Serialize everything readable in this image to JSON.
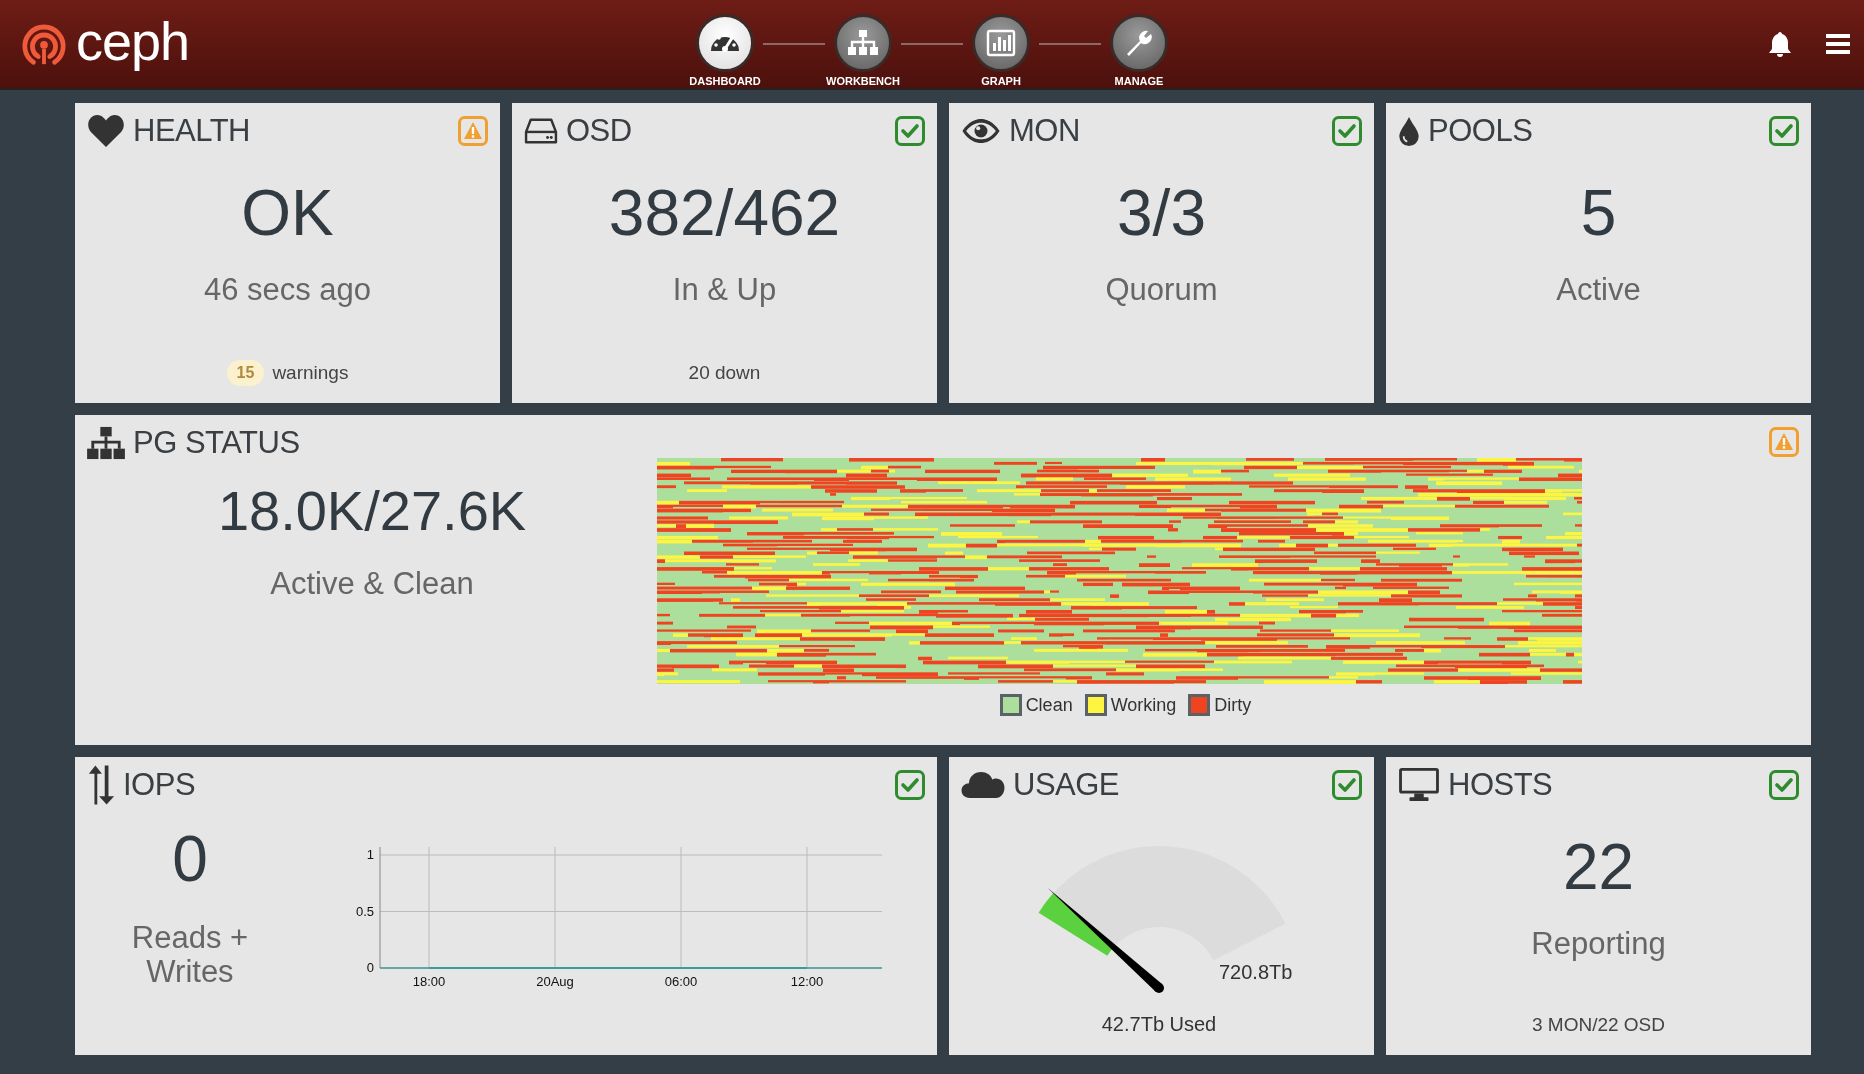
{
  "header": {
    "logo": "ceph",
    "nav": [
      {
        "label": "DASHBOARD",
        "selected": true
      },
      {
        "label": "WORKBENCH",
        "selected": false
      },
      {
        "label": "GRAPH",
        "selected": false
      },
      {
        "label": "MANAGE",
        "selected": false
      }
    ]
  },
  "summary_cards": [
    {
      "title": "HEALTH",
      "warning": true,
      "value": "OK",
      "subtitle": "46 secs ago",
      "badge": "15",
      "footer": "warnings"
    },
    {
      "title": "OSD",
      "warning": false,
      "value": "382/462",
      "subtitle": "In & Up",
      "footer": "20 down"
    },
    {
      "title": "MON",
      "warning": false,
      "value": "3/3",
      "subtitle": "Quorum"
    },
    {
      "title": "POOLS",
      "warning": false,
      "value": "5",
      "subtitle": "Active"
    }
  ],
  "pg_status": {
    "title": "PG STATUS",
    "warning": true,
    "value": "18.0K/27.6K",
    "subtitle": "Active & Clean",
    "legend": [
      {
        "label": "Clean",
        "color": "#addf9c"
      },
      {
        "label": "Working",
        "color": "#fdf542"
      },
      {
        "label": "Dirty",
        "color": "#ee4422"
      }
    ]
  },
  "iops": {
    "title": "IOPS",
    "warning": false,
    "value": "0",
    "subtitle": "Reads + Writes",
    "chart_data": {
      "type": "line",
      "categories": [
        "18:00",
        "20Aug",
        "06:00",
        "12:00"
      ],
      "series": [
        {
          "color": "#3f9a9a",
          "values": [
            0,
            0,
            0,
            0
          ]
        }
      ],
      "ylim": [
        0,
        1
      ],
      "yticks": [
        0,
        0.5,
        1
      ],
      "grid": true
    }
  },
  "usage": {
    "title": "USAGE",
    "warning": false,
    "capacity": "720.8Tb",
    "used": "42.7Tb Used"
  },
  "hosts": {
    "title": "HOSTS",
    "warning": false,
    "value": "22",
    "subtitle": "Reporting",
    "footer": "3 MON/22 OSD"
  }
}
